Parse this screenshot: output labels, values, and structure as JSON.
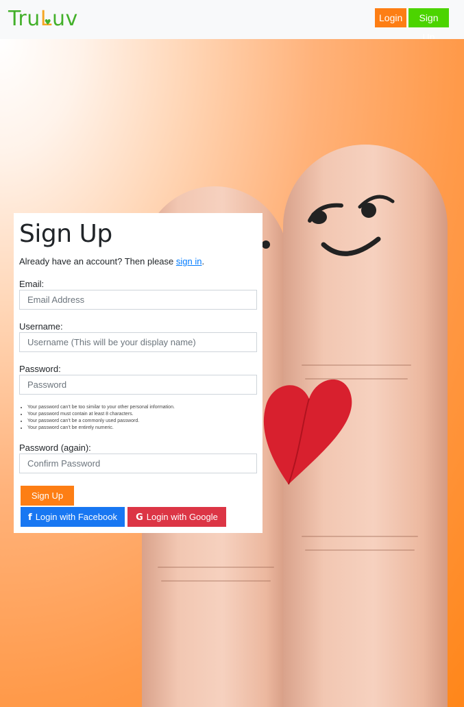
{
  "navbar": {
    "logo_text_start": "Tru",
    "logo_text_L": "L",
    "logo_text_end": "uv",
    "login_label": "Login",
    "signup_label": "Sign Up"
  },
  "form": {
    "title": "Sign Up",
    "already_text": "Already have an account? Then please ",
    "signin_link": "sign in",
    "period": ".",
    "email_label": "Email:",
    "email_placeholder": "Email Address",
    "username_label": "Username:",
    "username_placeholder": "Username (This will be your display name)",
    "password_label": "Password:",
    "password_placeholder": "Password",
    "password_help": [
      "Your password can’t be too similar to your other personal information.",
      "Your password must contain at least 8 characters.",
      "Your password can’t be a commonly used password.",
      "Your password can’t be entirely numeric."
    ],
    "password2_label": "Password (again):",
    "password2_placeholder": "Confirm Password",
    "signup_button": "Sign Up",
    "facebook_button": "Login with Facebook",
    "google_button": "Login with Google"
  },
  "icons": {
    "facebook": "facebook-icon",
    "google": "google-icon"
  },
  "colors": {
    "brand_green": "#43b02a",
    "accent_orange": "#fd7e14",
    "signup_green": "#4cd400",
    "facebook_blue": "#1877f2",
    "google_red": "#dc3545"
  }
}
